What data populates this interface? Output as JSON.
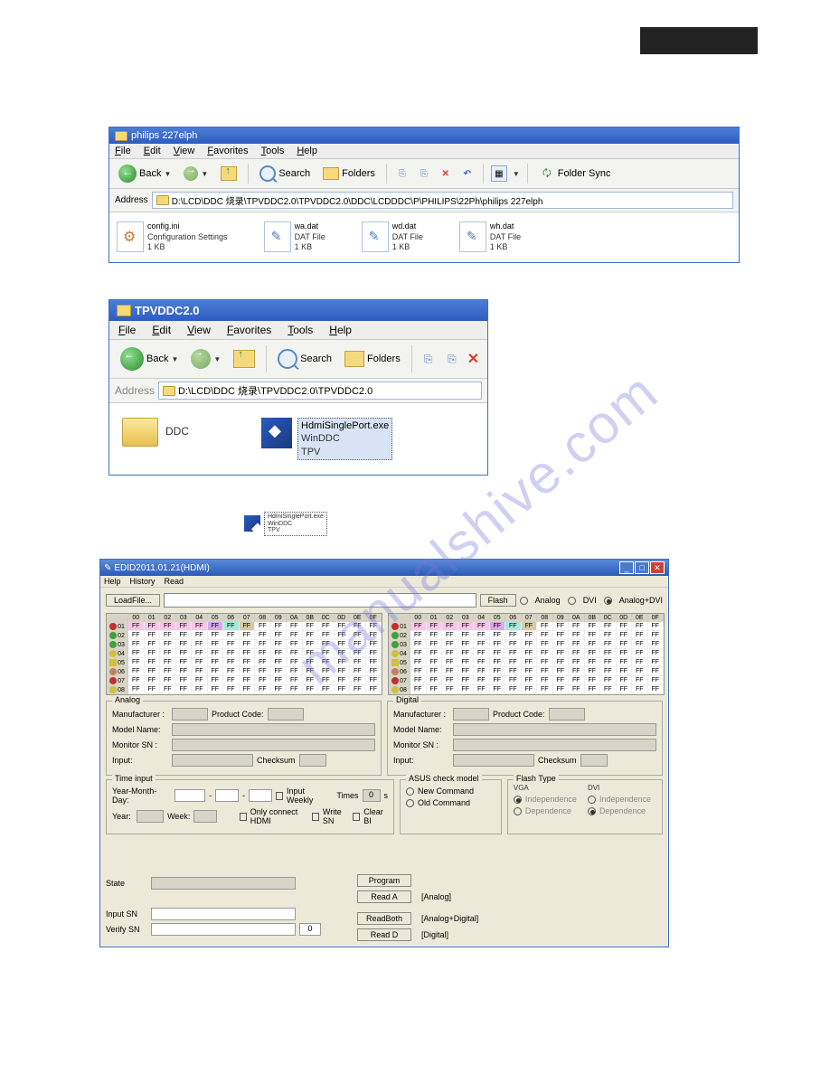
{
  "watermark": "manualshive.com",
  "explorer1": {
    "title": "philips 227elph",
    "menu": [
      "File",
      "Edit",
      "View",
      "Favorites",
      "Tools",
      "Help"
    ],
    "toolbar": {
      "back": "Back",
      "search": "Search",
      "folders": "Folders",
      "sync": "Folder Sync"
    },
    "address_label": "Address",
    "address": "D:\\LCD\\DDC 烧录\\TPVDDC2.0\\TPVDDC2.0\\DDC\\LCDDDC\\P\\PHILIPS\\22Ph\\philips 227elph",
    "files": [
      {
        "name": "config.ini",
        "type": "Configuration Settings",
        "size": "1 KB",
        "kind": "cfg"
      },
      {
        "name": "wa.dat",
        "type": "DAT File",
        "size": "1 KB",
        "kind": "dat"
      },
      {
        "name": "wd.dat",
        "type": "DAT File",
        "size": "1 KB",
        "kind": "dat"
      },
      {
        "name": "wh.dat",
        "type": "DAT File",
        "size": "1 KB",
        "kind": "dat"
      }
    ]
  },
  "explorer2": {
    "title": "TPVDDC2.0",
    "menu": [
      "File",
      "Edit",
      "View",
      "Favorites",
      "Tools",
      "Help"
    ],
    "toolbar": {
      "back": "Back",
      "search": "Search",
      "folders": "Folders"
    },
    "address_label": "Address",
    "address": "D:\\LCD\\DDC 烧录\\TPVDDC2.0\\TPVDDC2.0",
    "folder": "DDC",
    "exe": {
      "name": "HdmiSinglePort.exe",
      "line2": "WinDDC",
      "line3": "TPV"
    }
  },
  "small_exe": {
    "name": "HdmiSinglePort.exe",
    "line2": "WinDDC",
    "line3": "TPV"
  },
  "app": {
    "title": "EDID2011.01.21(HDMI)",
    "menu": [
      "Help",
      "History",
      "Read"
    ],
    "loadfile": "LoadFile...",
    "flash": "Flash",
    "mode": {
      "analog": "Analog",
      "dvi": "DVI",
      "analogdvi": "Analog+DVI"
    },
    "hex_headers": [
      "00",
      "01",
      "02",
      "03",
      "04",
      "05",
      "06",
      "07",
      "08",
      "09",
      "0A",
      "0B",
      "0C",
      "0D",
      "0E",
      "0F"
    ],
    "hex_rows": [
      "01",
      "02",
      "03",
      "04",
      "05",
      "06",
      "07",
      "08"
    ],
    "cell": "FF",
    "analog_legend": "Analog",
    "digital_legend": "Digital",
    "labels": {
      "manufacturer": "Manufacturer :",
      "productcode": "Product Code:",
      "modelname": "Model Name:",
      "monitorsn": "Monitor SN :",
      "input": "Input:",
      "checksum": "Checksum"
    },
    "timeinput": {
      "legend": "Time input",
      "ymd": "Year-Month-Day:",
      "inputweekly": "Input Weekly",
      "times": "Times",
      "timeval": "0",
      "s": "s",
      "year": "Year:",
      "week": "Week:",
      "onlyhdmi": "Only connect HDMI",
      "writesn": "Write SN",
      "clearbi": "Clear BI"
    },
    "asus": {
      "legend": "ASUS check model",
      "new": "New Command",
      "old": "Old Command"
    },
    "flashtype": {
      "legend": "Flash Type",
      "vga": "VGA",
      "dvi": "DVI",
      "ind": "Independence",
      "dep": "Dependence"
    },
    "bottom": {
      "state": "State",
      "inputsn": "Input SN",
      "verifysn": "Verify SN",
      "verifyval": "0",
      "program": "Program",
      "reada": "Read A",
      "readboth": "ReadBoth",
      "readd": "Read D",
      "analog": "[Analog]",
      "analogdigital": "[Analog+Digital]",
      "digital": "[Digital]"
    }
  }
}
